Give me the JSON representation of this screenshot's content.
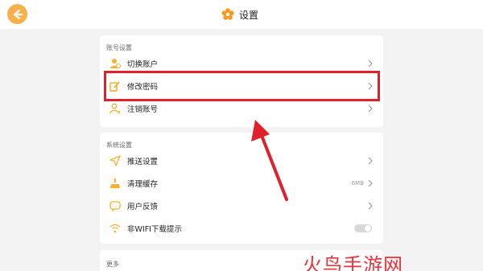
{
  "header": {
    "title": "设置"
  },
  "account": {
    "section_title": "账号设置",
    "items": [
      {
        "label": "切换账户"
      },
      {
        "label": "修改密码"
      },
      {
        "label": "注销账号"
      }
    ]
  },
  "system": {
    "section_title": "系统设置",
    "items": [
      {
        "label": "推送设置"
      },
      {
        "label": "清理缓存",
        "value": "6MB"
      },
      {
        "label": "用户反馈"
      },
      {
        "label": "非WIFI下载提示",
        "toggle_on": false
      }
    ]
  },
  "more": {
    "section_title": "更多"
  },
  "watermark": {
    "text": "火鸟手游网"
  },
  "colors": {
    "accent": "#f7b04b",
    "highlight": "#e0202a"
  }
}
